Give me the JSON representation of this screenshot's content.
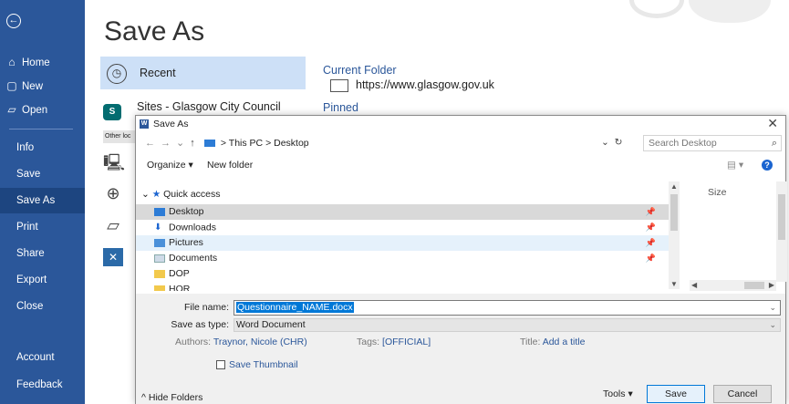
{
  "sidebar": {
    "home": "Home",
    "new": "New",
    "open": "Open",
    "info": "Info",
    "save": "Save",
    "save_as": "Save As",
    "print": "Print",
    "share": "Share",
    "export": "Export",
    "close": "Close",
    "account": "Account",
    "feedback": "Feedback"
  },
  "backstage": {
    "title": "Save As",
    "recent": "Recent",
    "sites": "Sites - Glasgow City Council",
    "other_locations": "Other loc",
    "current_folder_heading": "Current Folder",
    "current_folder_url": "https://www.glasgow.gov.uk",
    "pinned_heading": "Pinned"
  },
  "dialog": {
    "title": "Save As",
    "address": {
      "sep": ">",
      "this_pc": "This PC",
      "desktop": "Desktop"
    },
    "search_placeholder": "Search Desktop",
    "organize": "Organize ▾",
    "new_folder": "New folder",
    "nav": {
      "quick_access": "Quick access",
      "items": [
        "Desktop",
        "Downloads",
        "Pictures",
        "Documents",
        "DOP",
        "HOR"
      ]
    },
    "size_column": "Size",
    "file_name_label": "File name:",
    "file_name_value": "Questionnaire_NAME.docx",
    "save_as_type_label": "Save as type:",
    "save_as_type_value": "Word Document",
    "authors_label": "Authors:",
    "authors_value": "Traynor, Nicole (CHR)",
    "tags_label": "Tags:",
    "tags_value": "[OFFICIAL]",
    "title_label": "Title:",
    "title_value": "Add a title",
    "save_thumbnail": "Save Thumbnail",
    "hide_folders": "Hide Folders",
    "tools": "Tools",
    "save": "Save",
    "cancel": "Cancel"
  },
  "colors": {
    "ribbon": "#2b579a",
    "accent": "#0078d7"
  }
}
